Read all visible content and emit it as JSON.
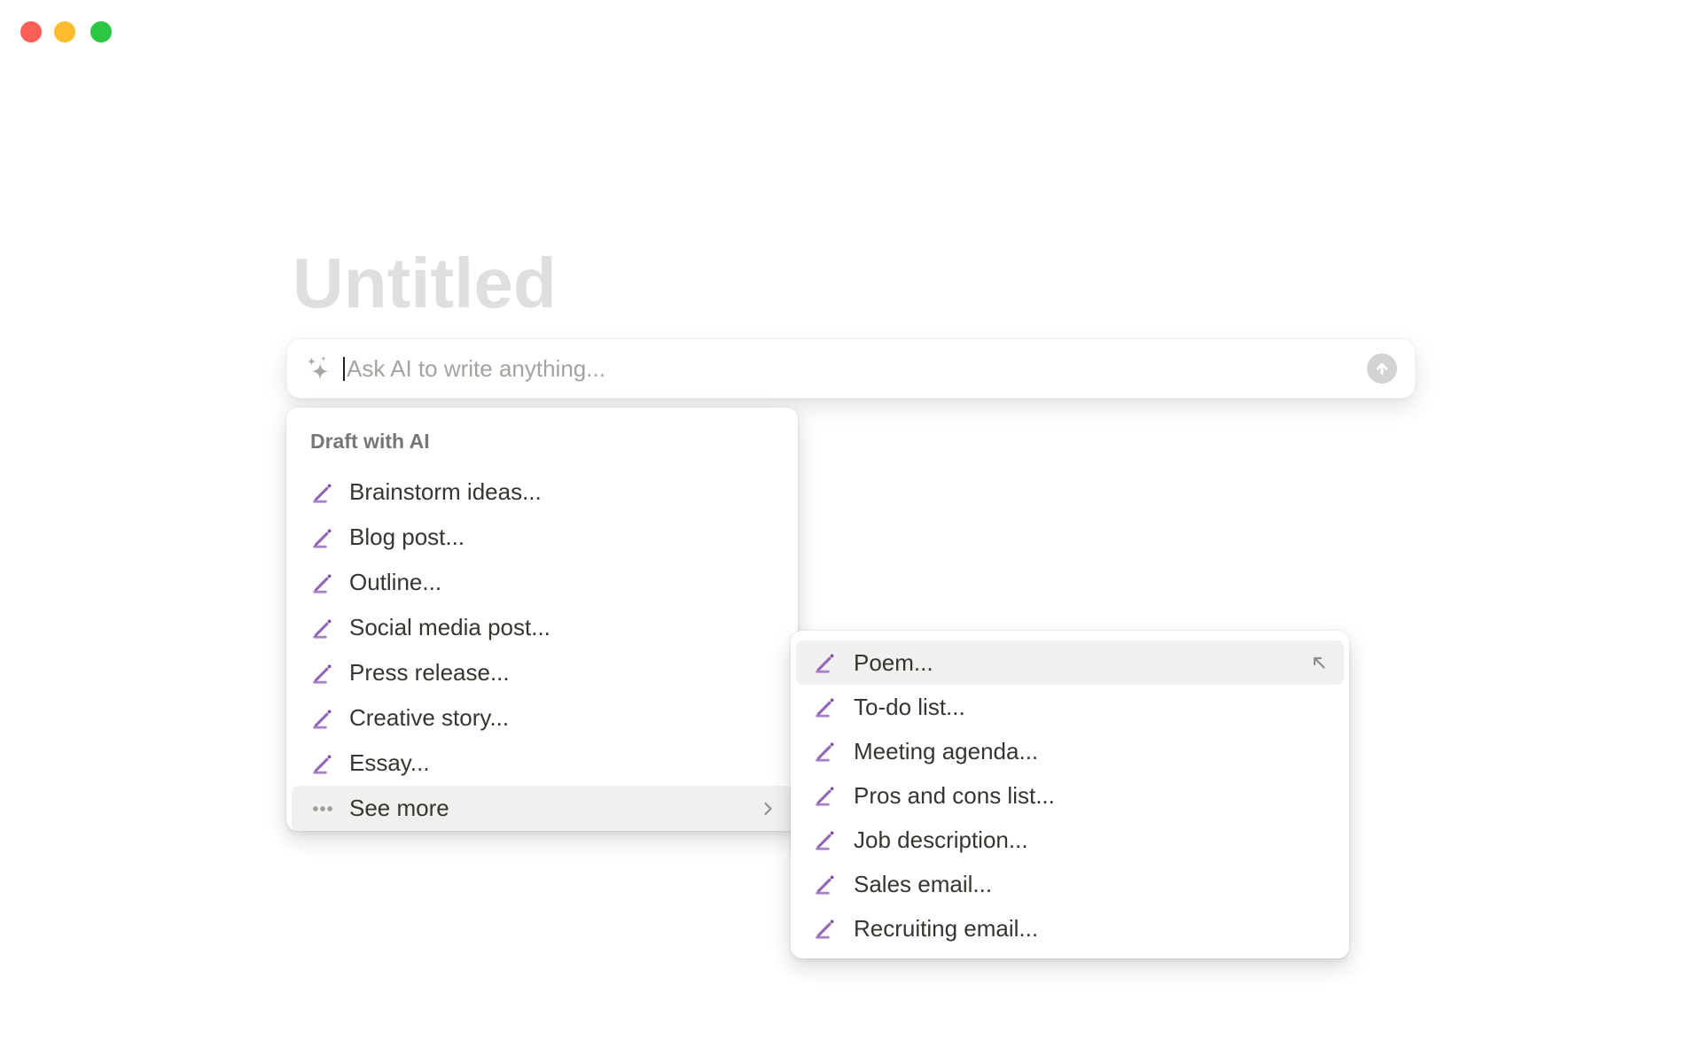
{
  "window": {
    "controls": [
      {
        "name": "close",
        "color": "#FF5F57"
      },
      {
        "name": "minimize",
        "color": "#FEBC2E"
      },
      {
        "name": "zoom",
        "color": "#2BC743"
      }
    ]
  },
  "page": {
    "title_placeholder": "Untitled"
  },
  "ai_input": {
    "placeholder": "Ask AI to write anything...",
    "leading_icon": "ai-sparkle-icon",
    "submit_icon": "arrow-up-icon"
  },
  "draft_menu": {
    "section_label": "Draft with AI",
    "items": [
      {
        "label": "Brainstorm ideas...",
        "icon": "pencil-draft-icon"
      },
      {
        "label": "Blog post...",
        "icon": "pencil-draft-icon"
      },
      {
        "label": "Outline...",
        "icon": "pencil-draft-icon"
      },
      {
        "label": "Social media post...",
        "icon": "pencil-draft-icon"
      },
      {
        "label": "Press release...",
        "icon": "pencil-draft-icon"
      },
      {
        "label": "Creative story...",
        "icon": "pencil-draft-icon"
      },
      {
        "label": "Essay...",
        "icon": "pencil-draft-icon"
      },
      {
        "label": "See more",
        "icon": "ellipsis-icon",
        "trailing_icon": "chevron-right-icon",
        "highlighted": true
      }
    ]
  },
  "see_more_submenu": {
    "items": [
      {
        "label": "Poem...",
        "icon": "pencil-draft-icon",
        "trailing_icon": "arrow-up-left-icon",
        "highlighted": true
      },
      {
        "label": "To-do list...",
        "icon": "pencil-draft-icon"
      },
      {
        "label": "Meeting agenda...",
        "icon": "pencil-draft-icon"
      },
      {
        "label": "Pros and cons list...",
        "icon": "pencil-draft-icon"
      },
      {
        "label": "Job description...",
        "icon": "pencil-draft-icon"
      },
      {
        "label": "Sales email...",
        "icon": "pencil-draft-icon"
      },
      {
        "label": "Recruiting email...",
        "icon": "pencil-draft-icon"
      }
    ]
  },
  "colors": {
    "accent_purple": "#9566B5",
    "menu_text": "#37352F",
    "section_label": "#787774",
    "placeholder": "#A6A39F",
    "hover_highlight": "#F1F0EE",
    "title_placeholder": "#E0DFDD",
    "submit_button": "#D5D3D1"
  }
}
